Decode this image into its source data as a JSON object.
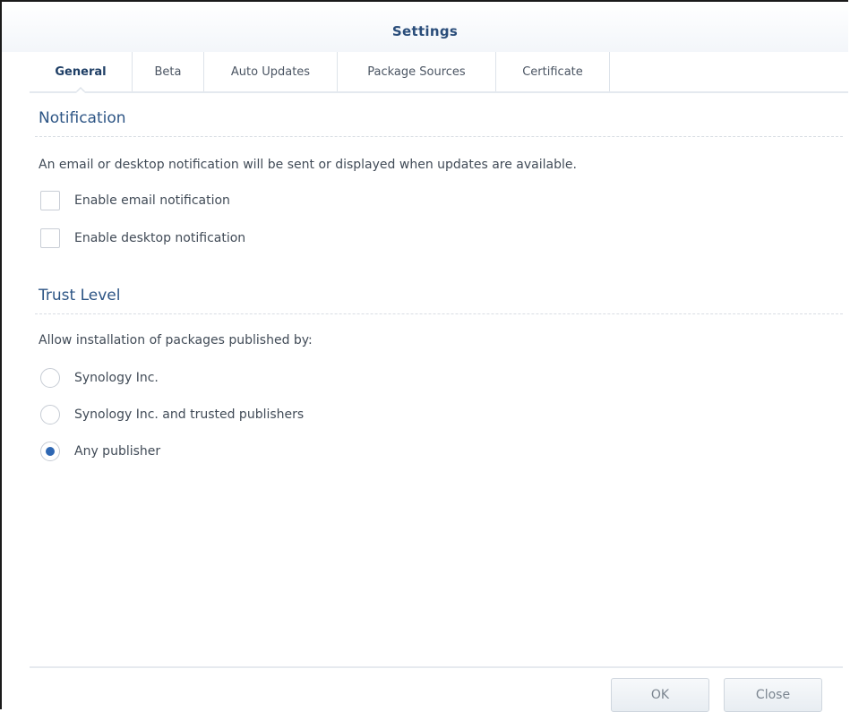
{
  "window": {
    "title": "Settings"
  },
  "tabs": [
    {
      "label": "General",
      "active": true
    },
    {
      "label": "Beta",
      "active": false
    },
    {
      "label": "Auto Updates",
      "active": false
    },
    {
      "label": "Package Sources",
      "active": false
    },
    {
      "label": "Certificate",
      "active": false
    }
  ],
  "notification": {
    "heading": "Notification",
    "description": "An email or desktop notification will be sent or displayed when updates are available.",
    "options": [
      {
        "label": "Enable email notification",
        "checked": false
      },
      {
        "label": "Enable desktop notification",
        "checked": false
      }
    ]
  },
  "trust_level": {
    "heading": "Trust Level",
    "description": "Allow installation of packages published by:",
    "options": [
      {
        "label": "Synology Inc.",
        "selected": false
      },
      {
        "label": "Synology Inc. and trusted publishers",
        "selected": false
      },
      {
        "label": "Any publisher",
        "selected": true
      }
    ]
  },
  "footer": {
    "ok_label": "OK",
    "close_label": "Close"
  },
  "colors": {
    "accent": "#2d5585",
    "radio_selected": "#2e67b3"
  }
}
